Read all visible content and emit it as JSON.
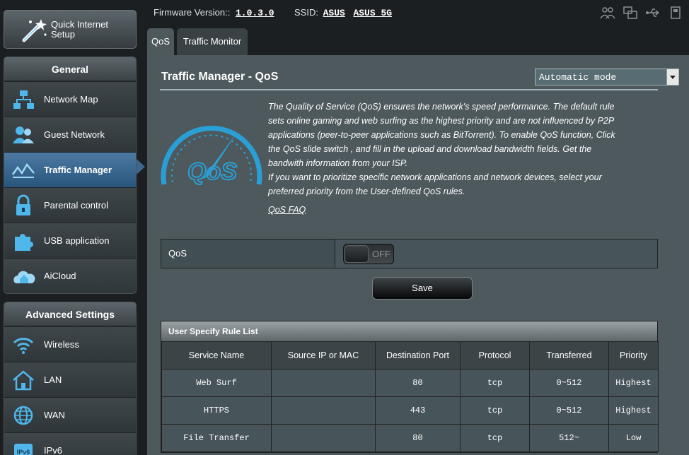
{
  "quick_setup": {
    "label_line1": "Quick Internet",
    "label_line2": "Setup"
  },
  "sidebar": {
    "general_title": "General",
    "general_items": [
      {
        "label": "Network Map"
      },
      {
        "label": "Guest Network"
      },
      {
        "label": "Traffic Manager"
      },
      {
        "label": "Parental control"
      },
      {
        "label": "USB application"
      },
      {
        "label": "AiCloud"
      }
    ],
    "advanced_title": "Advanced Settings",
    "advanced_items": [
      {
        "label": "Wireless"
      },
      {
        "label": "LAN"
      },
      {
        "label": "WAN"
      },
      {
        "label": "IPv6"
      }
    ]
  },
  "header": {
    "firmware_label": "Firmware Version::",
    "firmware_value": "1.0.3.0",
    "ssid_label": "SSID:",
    "ssid_1": "ASUS",
    "ssid_2": "ASUS_5G"
  },
  "tabs": [
    {
      "label": "QoS"
    },
    {
      "label": "Traffic Monitor"
    }
  ],
  "main": {
    "title": "Traffic Manager - QoS",
    "mode_select": "Automatic mode",
    "description_1": "The Quality of Service (QoS) ensures the network's speed performance. The default rule sets online gaming and web surfing as the highest priority and are not influenced by P2P applications (peer-to-peer applications such as BitTorrent). To enable QoS function, Click the QoS slide switch , and fill in the upload and download bandwidth fields. Get the bandwith information from your ISP.",
    "description_2": "If you want to prioritize specific network applications and network devices, select your preferred priority from the User-defined QoS rules.",
    "faq_link": "QoS FAQ",
    "qos_label": "QoS",
    "qos_toggle": "OFF",
    "save_label": "Save"
  },
  "rule_list": {
    "title": "User Specify Rule List",
    "columns": [
      "Service Name",
      "Source IP or MAC",
      "Destination Port",
      "Protocol",
      "Transferred",
      "Priority"
    ],
    "rows": [
      [
        "Web Surf",
        "",
        "80",
        "tcp",
        "0~512",
        "Highest"
      ],
      [
        "HTTPS",
        "",
        "443",
        "tcp",
        "0~512",
        "Highest"
      ],
      [
        "File Transfer",
        "",
        "80",
        "tcp",
        "512~",
        "Low"
      ]
    ]
  },
  "colors": {
    "accent": "#2a9fd6",
    "active_nav": "#3c6890",
    "panel": "#4d595d"
  }
}
